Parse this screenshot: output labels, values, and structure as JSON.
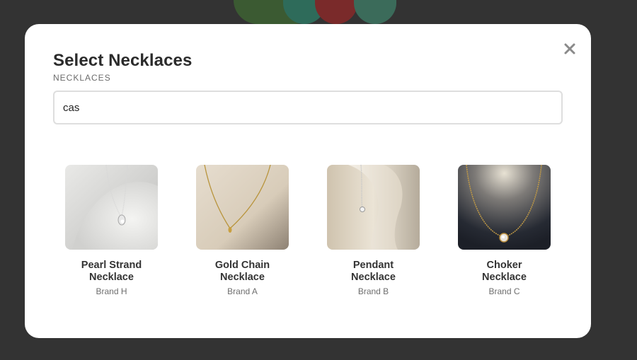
{
  "modal": {
    "title": "Select Necklaces",
    "subtitle": "NECKLACES",
    "close_icon": "close-icon"
  },
  "search": {
    "value": "cas",
    "placeholder": ""
  },
  "products": [
    {
      "name": "Pearl Strand Necklace",
      "brand": "Brand H",
      "image": "silver-pendant-on-white-bust"
    },
    {
      "name": "Gold Chain Necklace",
      "brand": "Brand A",
      "image": "gold-chain-on-beige"
    },
    {
      "name": "Pendant Necklace",
      "brand": "Brand B",
      "image": "diamond-necklace-on-display-stand"
    },
    {
      "name": "Choker Necklace",
      "brand": "Brand C",
      "image": "gold-choker-with-diamond-on-dark"
    }
  ],
  "colors": {
    "backdrop": "#333333",
    "modal_bg": "#ffffff",
    "title": "#2b2b2b",
    "subtitle": "#6b6b6b",
    "search_border": "#dedede"
  }
}
